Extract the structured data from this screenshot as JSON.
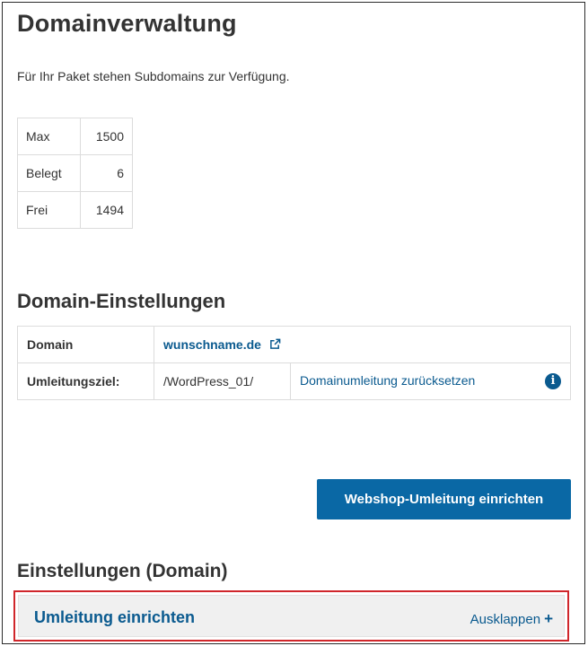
{
  "page": {
    "title": "Domainverwaltung",
    "intro": "Für Ihr Paket stehen Subdomains zur Verfügung."
  },
  "quota": {
    "rows": [
      {
        "label": "Max",
        "value": "1500"
      },
      {
        "label": "Belegt",
        "value": "6"
      },
      {
        "label": "Frei",
        "value": "1494"
      }
    ]
  },
  "domain_settings": {
    "heading": "Domain-Einstellungen",
    "domain_label": "Domain",
    "domain_value": "wunschname.de",
    "redirect_label": "Umleitungsziel:",
    "redirect_value": "/WordPress_01/",
    "reset_link": "Domainumleitung zurücksetzen",
    "icons": [
      "external-link-icon",
      "info-icon"
    ]
  },
  "webshop_button": "Webshop-Umleitung einrichten",
  "settings_domain": {
    "heading": "Einstellungen (Domain)",
    "panel_title": "Umleitung einrichten",
    "panel_toggle": "Ausklappen"
  },
  "colors": {
    "link": "#0a5a8f",
    "button": "#0a68a5",
    "highlight_border": "#d0262b"
  }
}
